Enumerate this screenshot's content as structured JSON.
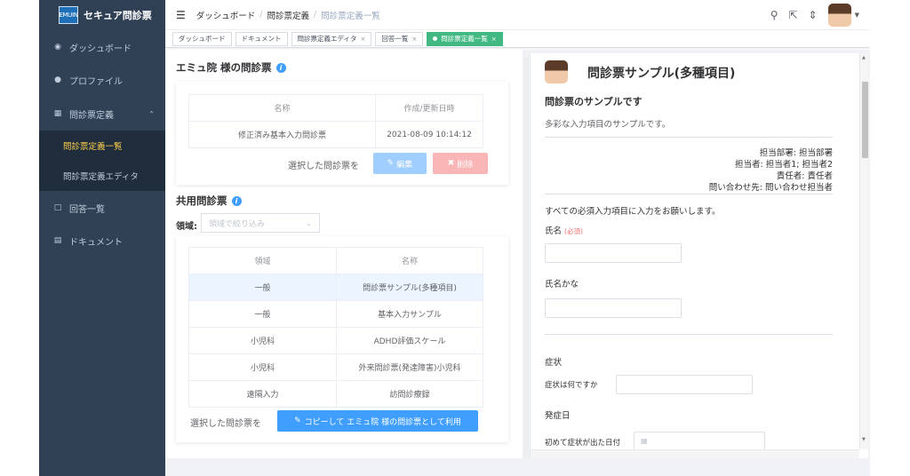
{
  "app": {
    "logo_mark": "EMUIN",
    "name": "セキュア問診票"
  },
  "sidebar": {
    "items": [
      {
        "label": "ダッシュボード",
        "icon": "dashboard-icon"
      },
      {
        "label": "プロファイル",
        "icon": "user-icon"
      },
      {
        "label": "問診票定義",
        "icon": "clipboard-icon"
      },
      {
        "label": "回答一覧",
        "icon": "folder-icon"
      },
      {
        "label": "ドキュメント",
        "icon": "document-icon"
      }
    ],
    "submenu": [
      {
        "label": "問診票定義一覧",
        "active": true
      },
      {
        "label": "問診票定義エディタ",
        "active": false
      }
    ]
  },
  "header": {
    "breadcrumb": [
      "ダッシュボード",
      "問診票定義",
      "問診票定義一覧"
    ]
  },
  "tags": [
    {
      "label": "ダッシュボード",
      "closable": false
    },
    {
      "label": "ドキュメント",
      "closable": false
    },
    {
      "label": "問診票定義エディタ",
      "closable": true
    },
    {
      "label": "回答一覧",
      "closable": true
    },
    {
      "label": "問診票定義一覧",
      "closable": true,
      "active": true
    }
  ],
  "own": {
    "title": "エミュ院 様の問診票",
    "columns": [
      "名称",
      "作成/更新日時"
    ],
    "rows": [
      {
        "name": "修正済み基本入力問診票",
        "updated": "2021-08-09 10:14:12"
      }
    ],
    "selected_label": "選択した問診票を",
    "edit_label": "編集",
    "delete_label": "削除"
  },
  "shared": {
    "title": "共用問診票",
    "domain_label": "領域:",
    "domain_placeholder": "領域で絞り込み",
    "columns": [
      "領域",
      "名称"
    ],
    "rows": [
      {
        "domain": "一般",
        "name": "問診票サンプル(多種項目)",
        "selected": true
      },
      {
        "domain": "一般",
        "name": "基本入力サンプル"
      },
      {
        "domain": "小児科",
        "name": "ADHD評価スケール"
      },
      {
        "domain": "小児科",
        "name": "外来問診票(発達障害)小児科"
      },
      {
        "domain": "遠隔入力",
        "name": "訪問診療録"
      }
    ],
    "selected_label": "選択した問診票を",
    "copy_label": "コピーして エミュ院 様の問診票として利用"
  },
  "preview": {
    "title": "問診票サンプル(多種項目)",
    "subtitle": "問診票のサンプルです",
    "description": "多彩な入力項目のサンプルです。",
    "meta": [
      "担当部署: 担当部署",
      "担当者: 担当者1; 担当者2",
      "責任者: 責任者",
      "問い合わせ先: 問い合わせ担当者"
    ],
    "instruction": "すべての必須入力項目に入力をお願いします。",
    "name_label": "氏名",
    "required_label": "(必須)",
    "kana_label": "氏名かな",
    "symptom_section": "症状",
    "symptom_question": "症状は何ですか",
    "onset_section": "発症日",
    "onset_question": "初めて症状が出た日付"
  }
}
